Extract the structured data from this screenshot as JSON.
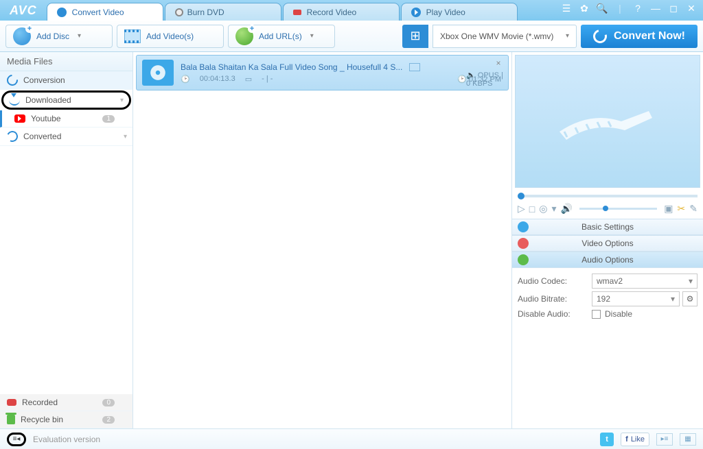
{
  "app": {
    "name": "AVC"
  },
  "tabs": {
    "convert": "Convert Video",
    "burn": "Burn DVD",
    "record": "Record Video",
    "play": "Play Video"
  },
  "toolbar": {
    "add_disc": "Add Disc",
    "add_videos": "Add Video(s)",
    "add_urls": "Add URL(s)",
    "profile": "Xbox One WMV Movie (*.wmv)",
    "convert_now": "Convert Now!"
  },
  "sidebar": {
    "header": "Media Files",
    "conversion": "Conversion",
    "downloaded": "Downloaded",
    "youtube": "Youtube",
    "youtube_count": "1",
    "converted": "Converted",
    "recorded": "Recorded",
    "recorded_count": "0",
    "recycle": "Recycle bin",
    "recycle_count": "2"
  },
  "media": {
    "title": "Bala Bala Shaitan Ka Sala Full Video Song _ Housefull 4 S...",
    "duration": "00:04:13.3",
    "dims": "- | -",
    "audio": "OPUS | 0 KBPS",
    "time": "01:32 PM"
  },
  "panels": {
    "basic": "Basic Settings",
    "video": "Video Options",
    "audio": "Audio Options",
    "audio_codec_label": "Audio Codec:",
    "audio_codec_value": "wmav2",
    "audio_bitrate_label": "Audio Bitrate:",
    "audio_bitrate_value": "192",
    "disable_audio_label": "Disable Audio:",
    "disable_audio_cb": "Disable"
  },
  "status": {
    "text": "Evaluation version",
    "like": "Like"
  }
}
